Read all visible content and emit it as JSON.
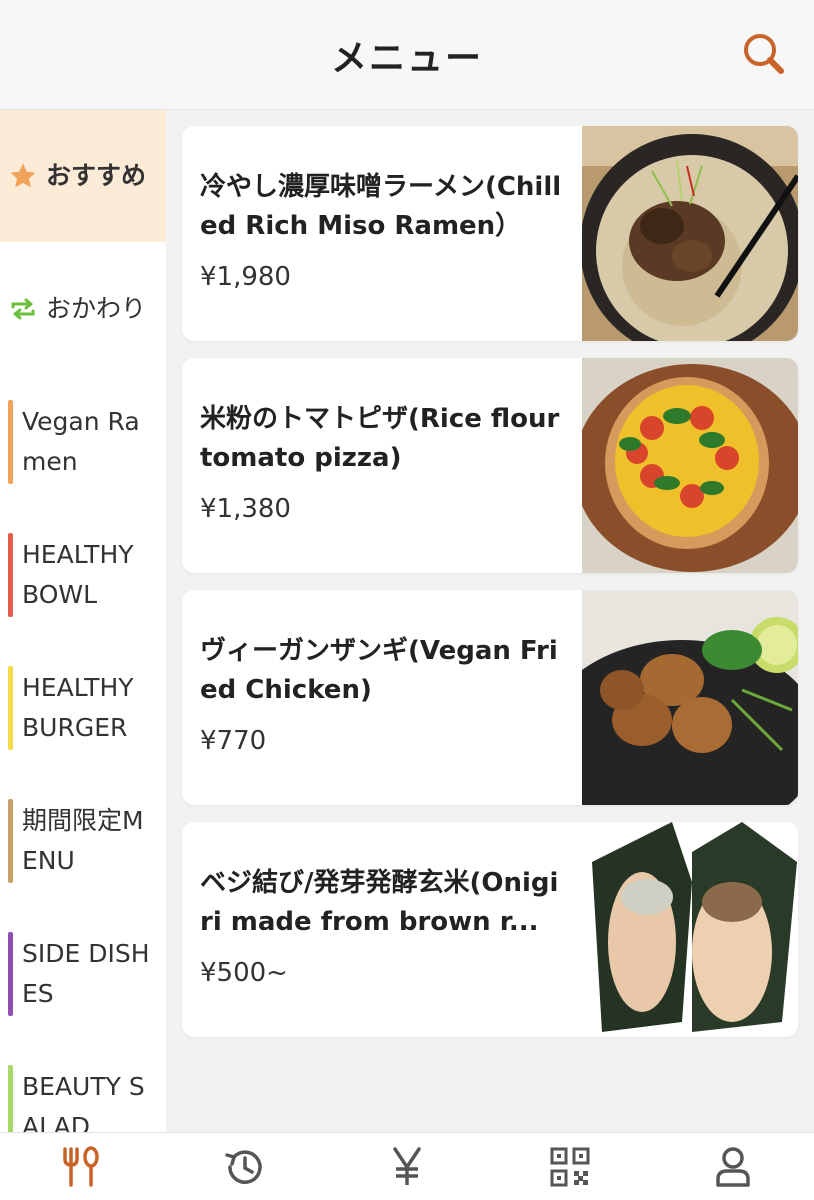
{
  "header": {
    "title": "メニュー"
  },
  "colors": {
    "accent": "#c8642a",
    "active_bg": "#fcebd7"
  },
  "sidebar": {
    "items": [
      {
        "label": "おすすめ",
        "icon": "star-icon",
        "active": true
      },
      {
        "label": "おかわり",
        "icon": "refresh-icon",
        "active": false
      },
      {
        "label": "Vegan Ramen",
        "bar_color": "#f0a35a"
      },
      {
        "label": "HEALTHY BOWL",
        "bar_color": "#e35d4f"
      },
      {
        "label": "HEALTHY BURGER",
        "bar_color": "#f3dc4c"
      },
      {
        "label": "期間限定MENU",
        "bar_color": "#c9a06a"
      },
      {
        "label": "SIDE DISHES",
        "bar_color": "#8e4fb3"
      },
      {
        "label": "BEAUTY SALAD",
        "bar_color": "#a8d86a"
      }
    ]
  },
  "menu": {
    "items": [
      {
        "name": "冷やし濃厚味噌ラーメン(Chilled Rich Miso Ramen）",
        "price": "¥1,980",
        "image": "miso-ramen-photo"
      },
      {
        "name": "米粉のトマトピザ(Rice flour tomato pizza)",
        "price": "¥1,380",
        "image": "tomato-pizza-photo"
      },
      {
        "name": "ヴィーガンザンギ(Vegan Fried Chicken)",
        "price": "¥770",
        "image": "fried-chicken-photo"
      },
      {
        "name": "ベジ結び/発芽発酵玄米(Onigiri made from brown r...",
        "price": "¥500~",
        "image": "onigiri-photo"
      }
    ]
  },
  "tabbar": {
    "tabs": [
      {
        "name": "menu-tab",
        "icon": "fork-knife-icon",
        "active": true
      },
      {
        "name": "history-tab",
        "icon": "history-icon",
        "active": false
      },
      {
        "name": "bill-tab",
        "icon": "yen-icon",
        "active": false
      },
      {
        "name": "qr-tab",
        "icon": "qr-code-icon",
        "active": false
      },
      {
        "name": "account-tab",
        "icon": "user-icon",
        "active": false
      }
    ]
  }
}
